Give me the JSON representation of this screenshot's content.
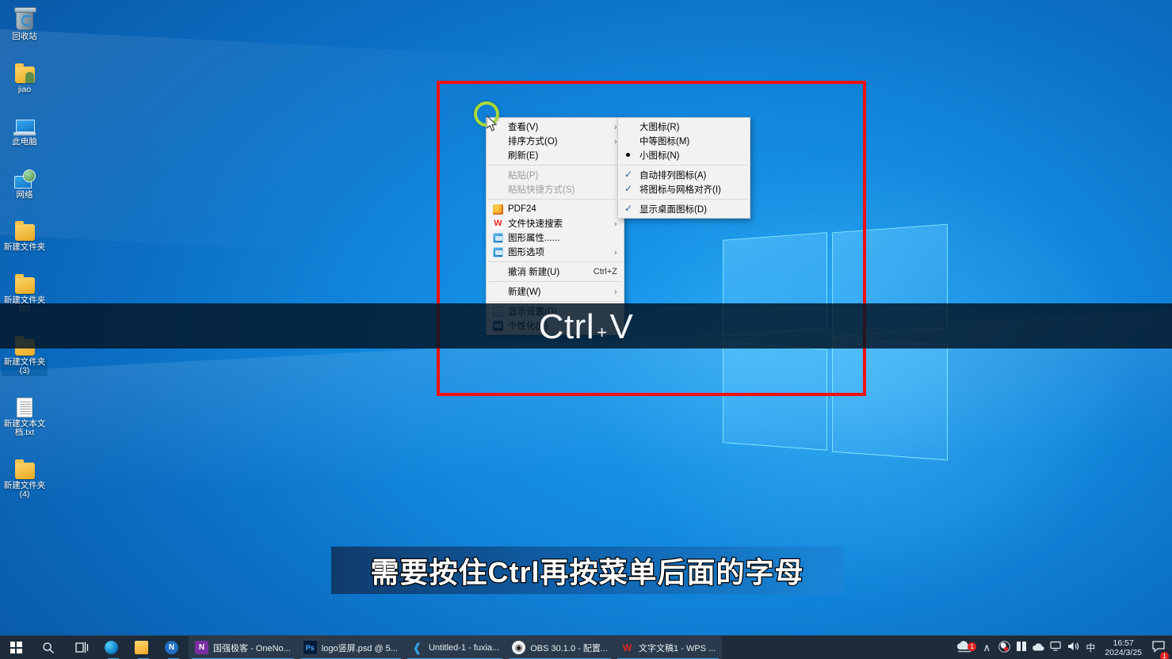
{
  "desktop": {
    "icons": [
      {
        "label": "回收站",
        "icon": "recycle-bin-icon",
        "selected": false
      },
      {
        "label": "jiao",
        "icon": "user-folder-icon",
        "selected": false
      },
      {
        "label": "此电脑",
        "icon": "this-pc-icon",
        "selected": false
      },
      {
        "label": "网络",
        "icon": "network-icon",
        "selected": false
      },
      {
        "label": "新建文件夹",
        "icon": "folder-icon",
        "selected": false
      },
      {
        "label": "新建文件夹 (2)",
        "icon": "folder-icon",
        "selected": false
      },
      {
        "label": "新建文件夹 (3)",
        "icon": "folder-icon",
        "selected": true
      },
      {
        "label": "新建文本文档.txt",
        "icon": "text-file-icon",
        "selected": false
      },
      {
        "label": "新建文件夹 (4)",
        "icon": "folder-icon",
        "selected": false
      }
    ]
  },
  "context_menu": {
    "items": [
      {
        "label": "查看(V)",
        "arrow": "›",
        "icon": null,
        "disabled": false,
        "accel": ""
      },
      {
        "label": "排序方式(O)",
        "arrow": "›",
        "icon": null,
        "disabled": false,
        "accel": ""
      },
      {
        "label": "刷新(E)",
        "arrow": "",
        "icon": null,
        "disabled": false,
        "accel": ""
      },
      {
        "separator": true
      },
      {
        "label": "粘贴(P)",
        "arrow": "",
        "icon": null,
        "disabled": true,
        "accel": ""
      },
      {
        "label": "粘贴快捷方式(S)",
        "arrow": "",
        "icon": null,
        "disabled": true,
        "accel": ""
      },
      {
        "separator": true
      },
      {
        "label": "PDF24",
        "arrow": "",
        "icon": "pdf24-icon",
        "disabled": false,
        "accel": ""
      },
      {
        "label": "文件快速搜索",
        "arrow": "›",
        "icon": "wps-icon",
        "disabled": false,
        "accel": ""
      },
      {
        "label": "图形属性......",
        "arrow": "",
        "icon": "intel-graphics-icon",
        "disabled": false,
        "accel": ""
      },
      {
        "label": "图形选项",
        "arrow": "›",
        "icon": "intel-graphics-icon",
        "disabled": false,
        "accel": ""
      },
      {
        "separator": true
      },
      {
        "label": "撤消 新建(U)",
        "arrow": "",
        "icon": null,
        "disabled": false,
        "accel": "Ctrl+Z"
      },
      {
        "separator": true
      },
      {
        "label": "新建(W)",
        "arrow": "›",
        "icon": null,
        "disabled": false,
        "accel": ""
      },
      {
        "separator": true
      },
      {
        "label": "显示设置(D)",
        "arrow": "",
        "icon": "display-settings-icon",
        "disabled": false,
        "accel": ""
      },
      {
        "label": "个性化(R)",
        "arrow": "",
        "icon": "personalize-icon",
        "disabled": false,
        "accel": ""
      }
    ]
  },
  "submenu": {
    "items": [
      {
        "label": "大图标(R)",
        "mark": "none"
      },
      {
        "label": "中等图标(M)",
        "mark": "none"
      },
      {
        "label": "小图标(N)",
        "mark": "bullet"
      },
      {
        "separator": true
      },
      {
        "label": "自动排列图标(A)",
        "mark": "check"
      },
      {
        "label": "将图标与网格对齐(I)",
        "mark": "check"
      },
      {
        "separator": true
      },
      {
        "label": "显示桌面图标(D)",
        "mark": "check"
      }
    ]
  },
  "overlay": {
    "key_main": "Ctrl",
    "key_plus": "+",
    "key_second": "V",
    "subtitle": "需要按住Ctrl再按菜单后面的字母"
  },
  "annotation": {
    "rect_color": "#f01010",
    "ring_color": "#a8d93a"
  },
  "taskbar": {
    "start_label": "开始",
    "search_glyph": "⌕",
    "taskview_glyph": "⌸",
    "apps": [
      {
        "name": "edge",
        "label": "",
        "short": "e",
        "color": "#1b74bb",
        "state": "pinned"
      },
      {
        "name": "file-explorer",
        "label": "",
        "short": "▤",
        "color": "#f3b24a",
        "state": "pinned"
      },
      {
        "name": "onenote-pinned",
        "label": "",
        "short": "N",
        "color": "#1c63b8",
        "state": "pinned"
      },
      {
        "name": "onenote-window",
        "label": "国强极客 - OneNo...",
        "short": "N",
        "color": "#7b2fa0",
        "state": "open"
      },
      {
        "name": "photoshop",
        "label": "logo竖屏.psd @ 5...",
        "short": "Ps",
        "color": "#0a1a33",
        "state": "open"
      },
      {
        "name": "vscode",
        "label": "Untitled-1 - fuxia...",
        "short": "✕",
        "color": "#1b74bb",
        "state": "open"
      },
      {
        "name": "obs",
        "label": "OBS 30.1.0 - 配置...",
        "short": "◉",
        "color": "#e8e8e8",
        "state": "open"
      },
      {
        "name": "wps",
        "label": "文字文稿1 - WPS ...",
        "short": "W",
        "color": "#ffffff",
        "state": "open"
      }
    ],
    "tray": {
      "cloud_badge": "1",
      "chevron": "∧",
      "icons": [
        "◑",
        "⬛",
        "☁",
        "὚5",
        "ὐA"
      ],
      "ime": "中",
      "time": "16:57",
      "date": "2024/3/25",
      "notify_badge": "1"
    }
  }
}
